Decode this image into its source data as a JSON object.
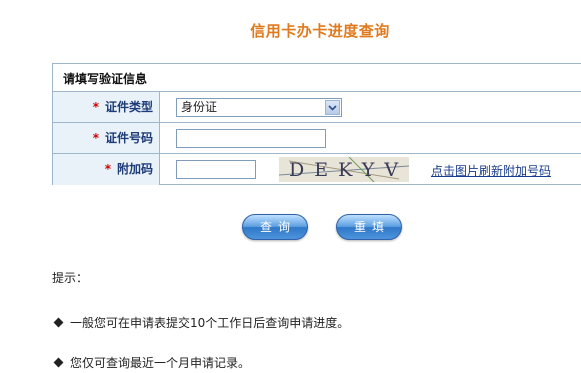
{
  "page_title": "信用卡办卡进度查询",
  "form": {
    "header": "请填写验证信息",
    "required_mark": "*",
    "id_type_label": "证件类型",
    "id_type_value": "身份证",
    "id_number_label": "证件号码",
    "id_number_value": "",
    "captcha_label": "附加码",
    "captcha_value": "",
    "captcha_image_text": "DEKYV",
    "captcha_refresh_link": "点击图片刷新附加号码"
  },
  "buttons": {
    "query": "查询",
    "reset": "重填"
  },
  "tips": {
    "label": "提示：",
    "items": [
      "一般您可在申请表提交10个工作日后查询申请进度。",
      "您仅可查询最近一个月申请记录。"
    ]
  },
  "colors": {
    "title": "#e07a1f",
    "label_bg": "#e9f1f9",
    "label_text": "#1e3c78",
    "required": "#d40000",
    "border": "#9fb6cd",
    "button": "#2f78c8"
  }
}
